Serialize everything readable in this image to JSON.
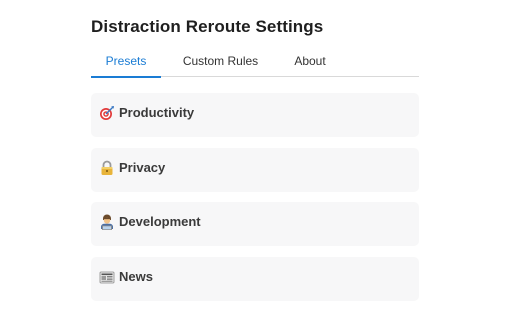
{
  "window": {
    "title": "Distraction Reroute Settings"
  },
  "tabs": [
    {
      "label": "Presets",
      "active": true
    },
    {
      "label": "Custom Rules",
      "active": false
    },
    {
      "label": "About",
      "active": false
    }
  ],
  "presets": [
    {
      "label": "Productivity",
      "icon": "target-icon"
    },
    {
      "label": "Privacy",
      "icon": "lock-icon"
    },
    {
      "label": "Development",
      "icon": "technologist-icon"
    },
    {
      "label": "News",
      "icon": "newspaper-icon"
    }
  ],
  "colors": {
    "accent": "#1a7cd4",
    "card_bg": "#f7f7f8",
    "divider": "#d9d9d9"
  }
}
